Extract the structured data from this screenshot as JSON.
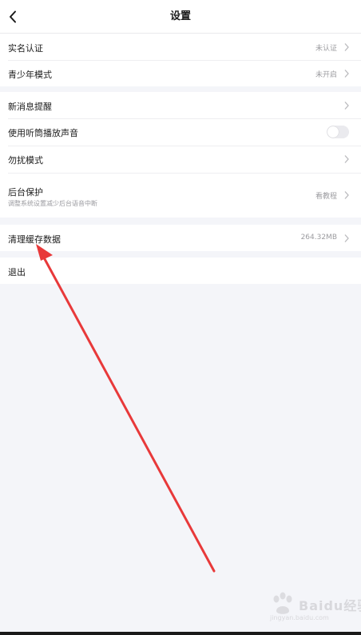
{
  "header": {
    "title": "设置",
    "back_icon": "chevron-left-icon"
  },
  "groups": [
    {
      "items": [
        {
          "label": "实名认证",
          "value": "未认证",
          "control": "chevron"
        },
        {
          "label": "青少年模式",
          "value": "未开启",
          "control": "chevron"
        }
      ]
    },
    {
      "items": [
        {
          "label": "新消息提醒",
          "control": "chevron"
        },
        {
          "label": "使用听筒播放声音",
          "control": "toggle",
          "toggle_on": false
        },
        {
          "label": "勿扰模式",
          "control": "chevron"
        },
        {
          "label": "后台保护",
          "sublabel": "调整系统设置减少后台语音中断",
          "value": "看教程",
          "control": "chevron"
        }
      ]
    },
    {
      "items": [
        {
          "label": "清理缓存数据",
          "value": "264.32MB",
          "control": "chevron"
        }
      ]
    },
    {
      "items": [
        {
          "label": "退出"
        }
      ]
    }
  ],
  "annotation": {
    "arrow_color": "#e8393a"
  },
  "watermark": {
    "brand": "Baidu经验",
    "url": "jingyan.baidu.com"
  },
  "colors": {
    "background": "#f4f5f9",
    "text": "#1b1b1b",
    "secondary_text": "#9c9ca0",
    "toggle_off": "#eaeaee"
  }
}
